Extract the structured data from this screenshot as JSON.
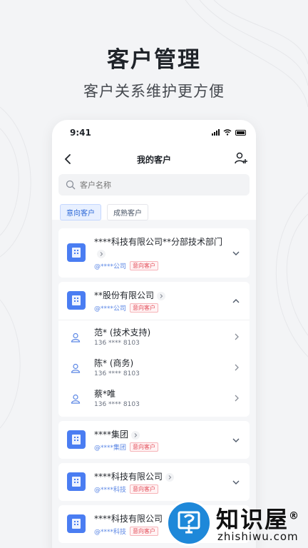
{
  "hero": {
    "title": "客户管理",
    "subtitle": "客户关系维护更方便"
  },
  "status_bar": {
    "time": "9:41"
  },
  "navbar": {
    "title": "我的客户",
    "back_icon": "chevron-left-icon",
    "add_icon": "add-user-icon"
  },
  "search": {
    "placeholder": "客户名称"
  },
  "tabs": [
    {
      "label": "意向客户",
      "active": true
    },
    {
      "label": "成熟客户",
      "active": false
    }
  ],
  "companies": [
    {
      "name": "****科技有限公司**分部技术部门",
      "at": "@****公司",
      "badge": "意向客户",
      "expanded": false
    },
    {
      "name": "**股份有限公司",
      "at": "@****公司",
      "badge": "意向客户",
      "expanded": true,
      "contacts": [
        {
          "name": "范* (技术支持)",
          "phone": "136 **** 8103"
        },
        {
          "name": "陈* (商务)",
          "phone": "136 **** 8103"
        },
        {
          "name": "蔡*唯",
          "phone": "136 **** 8103"
        }
      ]
    },
    {
      "name": "****集团",
      "at": "@****集团",
      "badge": "意向客户",
      "expanded": false
    },
    {
      "name": "****科技有限公司",
      "at": "@****科技",
      "badge": "意向客户",
      "expanded": false
    },
    {
      "name": "****科技有限公司",
      "at": "@****科技",
      "badge": "意向客户",
      "expanded": false
    }
  ],
  "watermark": {
    "text": "知识屋",
    "registered": "®",
    "url": "zhishiwu.com"
  },
  "colors": {
    "accent": "#4a7df2",
    "badge_red": "#e34d59",
    "watermark_blue": "#1e88d9"
  }
}
